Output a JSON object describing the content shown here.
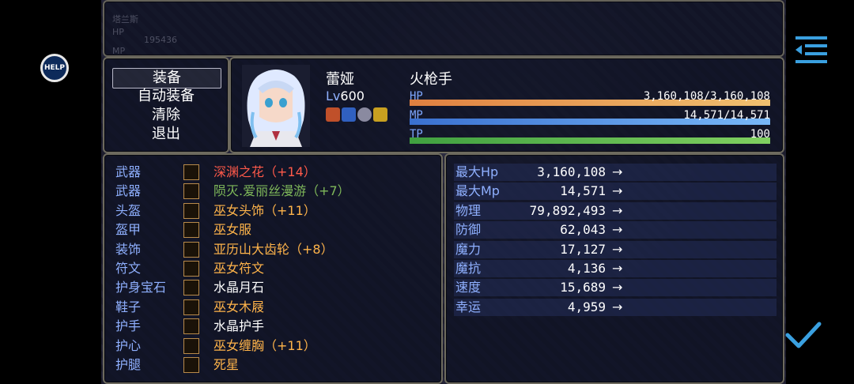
{
  "background_text": {
    "name": "塔兰斯",
    "hp_label": "HP",
    "hp_value": "195436",
    "mp_label": "MP"
  },
  "help_button": {
    "label": "HELP"
  },
  "commands": [
    "装备",
    "自动装备",
    "清除",
    "退出"
  ],
  "actor": {
    "name": "蕾娅",
    "level_label": "Lv",
    "level": "600",
    "class": "火枪手",
    "hp_label": "HP",
    "hp_value": "3,160,108/3,160,108",
    "hp_ratio": 1.0,
    "mp_label": "MP",
    "mp_value": "14,571/14,571",
    "mp_ratio": 1.0,
    "tp_label": "TP",
    "tp_value": "100",
    "tp_ratio": 1.0,
    "state_icons": [
      "atk-up-icon",
      "defense-icon",
      "skull-icon",
      "star-icon"
    ]
  },
  "equipment": [
    {
      "slot": "武器",
      "name": "深渊之花",
      "plus": "（+14）",
      "color": "red",
      "icon": "gun-icon"
    },
    {
      "slot": "武器",
      "name": "陨灭.爱丽丝漫游",
      "plus": "（+7）",
      "color": "green",
      "icon": "rifle-icon"
    },
    {
      "slot": "头盔",
      "name": "巫女头饰",
      "plus": "（+11）",
      "color": "gold",
      "icon": "headband-icon"
    },
    {
      "slot": "盔甲",
      "name": "巫女服",
      "plus": "",
      "color": "gold",
      "icon": "robe-icon"
    },
    {
      "slot": "装饰",
      "name": "亚历山大齿轮",
      "plus": "（+8）",
      "color": "gold",
      "icon": "gear-ring-icon"
    },
    {
      "slot": "符文",
      "name": "巫女符文",
      "plus": "",
      "color": "gold",
      "icon": "rune-icon"
    },
    {
      "slot": "护身宝石",
      "name": "水晶月石",
      "plus": "",
      "color": "white",
      "icon": "moonstone-icon"
    },
    {
      "slot": "鞋子",
      "name": "巫女木屐",
      "plus": "",
      "color": "gold",
      "icon": "clog-icon"
    },
    {
      "slot": "护手",
      "name": "水晶护手",
      "plus": "",
      "color": "white",
      "icon": "gauntlet-icon"
    },
    {
      "slot": "护心",
      "name": "巫女缠胸",
      "plus": "（+11）",
      "color": "gold",
      "icon": "chest-wrap-icon"
    },
    {
      "slot": "护腿",
      "name": "死星",
      "plus": "",
      "color": "gold",
      "icon": "death-star-icon"
    }
  ],
  "params": [
    {
      "name": "最大Hp",
      "value": "3,160,108",
      "arrow": "→"
    },
    {
      "name": "最大Mp",
      "value": "14,571",
      "arrow": "→"
    },
    {
      "name": "物理",
      "value": "79,892,493",
      "arrow": "→"
    },
    {
      "name": "防御",
      "value": "62,043",
      "arrow": "→"
    },
    {
      "name": "魔力",
      "value": "17,127",
      "arrow": "→"
    },
    {
      "name": "魔抗",
      "value": "4,136",
      "arrow": "→"
    },
    {
      "name": "速度",
      "value": "15,689",
      "arrow": "→"
    },
    {
      "name": "幸运",
      "value": "4,959",
      "arrow": "→"
    }
  ],
  "colors": {
    "hp": "#f0a860",
    "mp": "#5aa0f0",
    "tp": "#60c060",
    "slot_label": "#8fb0ff"
  }
}
